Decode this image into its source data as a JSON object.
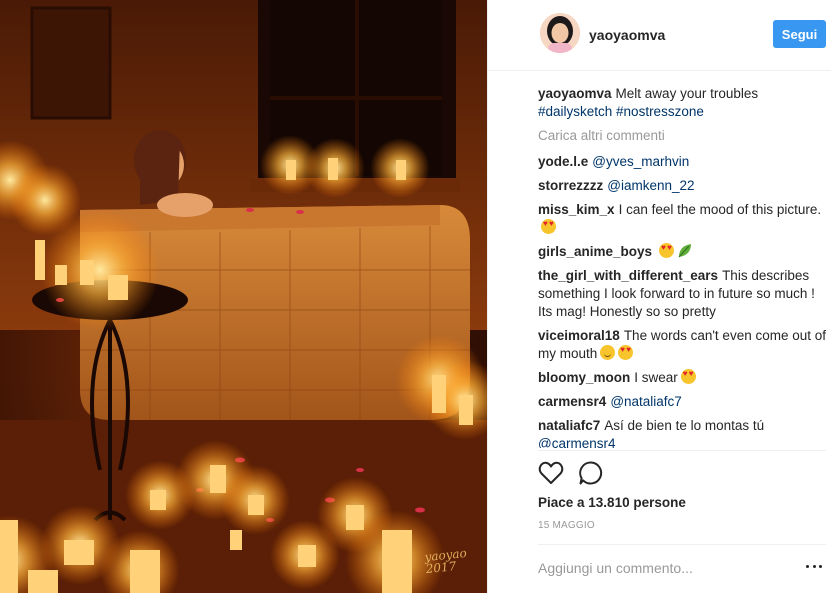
{
  "post": {
    "author": "yaoyaomva",
    "follow_label": "Segui"
  },
  "caption": {
    "user": "yaoyaomva",
    "text": "Melt away your troubles",
    "tags": "#dailysketch #nostresszone"
  },
  "load_more_label": "Carica altri commenti",
  "comments": [
    {
      "user": "yode.l.e",
      "text": "@yves_marhvin"
    },
    {
      "user": "storrezzzz",
      "text": "@iamkenn_22"
    },
    {
      "user": "miss_kim_x",
      "text": "I can feel the mood of this picture."
    },
    {
      "user": "girls_anime_boys",
      "text": ""
    },
    {
      "user": "the_girl_with_different_ears",
      "text": "This describes something I look forward to in future so much ! Its mag! Honestly so so pretty"
    },
    {
      "user": "viceimoral18",
      "text": "The words can't even come out of my mouth"
    },
    {
      "user": "bloomy_moon",
      "text": "I swear"
    },
    {
      "user": "carmensr4",
      "text": "@nataliafc7"
    },
    {
      "user": "nataliafc7",
      "text": "Así de bien te lo montas tú",
      "mention": "@carmensr4"
    }
  ],
  "likes": {
    "label": "Piace a 13.810 persone"
  },
  "date": "15 MAGGIO",
  "add_comment_placeholder": "Aggiungi un commento...",
  "artwork": {
    "signature": "yaoyao 2017"
  },
  "icons": {
    "like": "heart-outline-icon",
    "comment": "speech-bubble-icon",
    "more": "more-dots-icon"
  },
  "colors": {
    "follow_button": "#3897f0",
    "hashtag": "#003569",
    "muted": "#999999"
  }
}
